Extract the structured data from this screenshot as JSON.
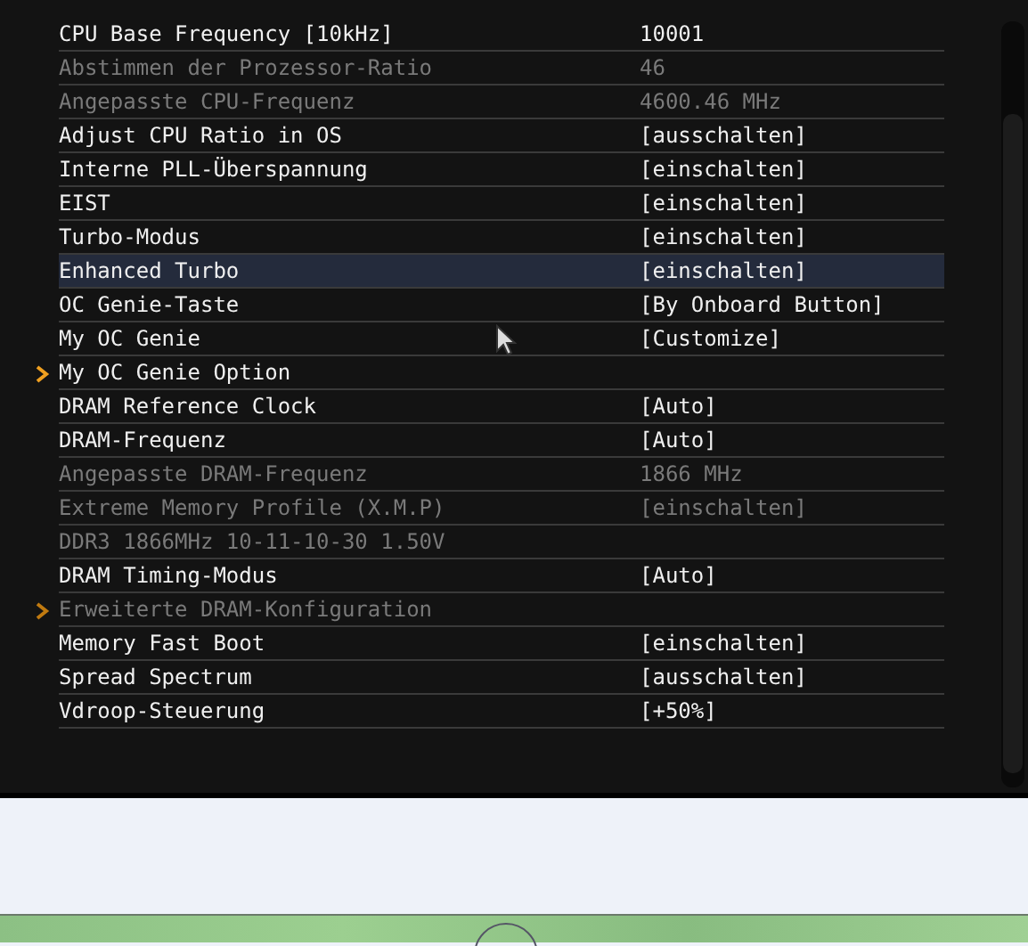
{
  "settings": [
    {
      "label": "CPU Base Frequency [10kHz]",
      "value": "10001",
      "disabled": false,
      "selected": false,
      "submenu": false
    },
    {
      "label": "Abstimmen der Prozessor-Ratio",
      "value": "46",
      "disabled": true,
      "selected": false,
      "submenu": false
    },
    {
      "label": "Angepasste CPU-Frequenz",
      "value": "4600.46 MHz",
      "disabled": true,
      "selected": false,
      "submenu": false
    },
    {
      "label": "Adjust CPU Ratio in OS",
      "value": "[ausschalten]",
      "disabled": false,
      "selected": false,
      "submenu": false
    },
    {
      "label": "Interne PLL-Überspannung",
      "value": "[einschalten]",
      "disabled": false,
      "selected": false,
      "submenu": false
    },
    {
      "label": "EIST",
      "value": "[einschalten]",
      "disabled": false,
      "selected": false,
      "submenu": false
    },
    {
      "label": "Turbo-Modus",
      "value": "[einschalten]",
      "disabled": false,
      "selected": false,
      "submenu": false
    },
    {
      "label": "Enhanced Turbo",
      "value": "[einschalten]",
      "disabled": false,
      "selected": true,
      "submenu": false
    },
    {
      "label": "OC Genie-Taste",
      "value": "[By Onboard Button]",
      "disabled": false,
      "selected": false,
      "submenu": false
    },
    {
      "label": "My OC Genie",
      "value": "[Customize]",
      "disabled": false,
      "selected": false,
      "submenu": false
    },
    {
      "label": "My OC Genie Option",
      "disabled": false,
      "selected": false,
      "submenu": true
    },
    {
      "label": "DRAM Reference Clock",
      "value": "[Auto]",
      "disabled": false,
      "selected": false,
      "submenu": false
    },
    {
      "label": "DRAM-Frequenz",
      "value": "[Auto]",
      "disabled": false,
      "selected": false,
      "submenu": false
    },
    {
      "label": "Angepasste DRAM-Frequenz",
      "value": "1866 MHz",
      "disabled": true,
      "selected": false,
      "submenu": false
    },
    {
      "label": "Extreme Memory Profile (X.M.P)",
      "value": "[einschalten]",
      "disabled": true,
      "selected": false,
      "submenu": false
    },
    {
      "label": "DDR3 1866MHz 10-11-10-30 1.50V",
      "disabled": true,
      "selected": false,
      "submenu": false
    },
    {
      "label": "DRAM Timing-Modus",
      "value": "[Auto]",
      "disabled": false,
      "selected": false,
      "submenu": false
    },
    {
      "label": "Erweiterte DRAM-Konfiguration",
      "disabled": true,
      "selected": false,
      "submenu": true
    },
    {
      "label": "Memory Fast Boot",
      "value": "[einschalten]",
      "disabled": false,
      "selected": false,
      "submenu": false
    },
    {
      "label": "Spread Spectrum",
      "value": "[ausschalten]",
      "disabled": false,
      "selected": false,
      "submenu": false
    },
    {
      "label": "Vdroop-Steuerung",
      "value": "[+50%]",
      "disabled": false,
      "selected": false,
      "submenu": false
    }
  ]
}
